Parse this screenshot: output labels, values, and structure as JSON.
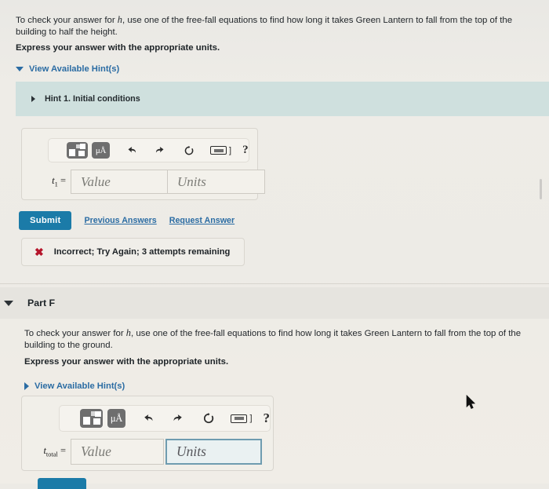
{
  "part_e": {
    "question_prefix": "To check your answer for ",
    "question_var": "h",
    "question_rest": ", use one of the free-fall equations to find how long it takes Green Lantern to fall from the top of the building to half the height.",
    "instruction": "Express your answer with the appropriate units.",
    "hints_toggle": "View Available Hint(s)",
    "hint_item": "Hint 1. Initial conditions",
    "toolbar": {
      "template_label": "template-picker",
      "units_label": "μÅ",
      "undo_label": "undo",
      "redo_label": "redo",
      "reset_label": "reset",
      "keyboard_label": "keyboard-shortcuts",
      "keyboard_bracket": "]",
      "help_label": "?"
    },
    "answer": {
      "lhs_var": "t",
      "lhs_sub": "1",
      "lhs_eq": " =",
      "value_placeholder": "Value",
      "units_placeholder": "Units",
      "value_text": "",
      "units_text": ""
    },
    "submit_label": "Submit",
    "previous_answers_label": "Previous Answers",
    "request_answer_label": "Request Answer",
    "feedback": {
      "icon": "✖",
      "text": "Incorrect; Try Again; 3 attempts remaining"
    }
  },
  "part_f": {
    "header_title": "Part F",
    "question_prefix": "To check your answer for ",
    "question_var": "h",
    "question_rest": ", use one of the free-fall equations to find how long it takes Green Lantern to fall from the top of the building to the ground.",
    "instruction": "Express your answer with the appropriate units.",
    "hints_toggle": "View Available Hint(s)",
    "toolbar": {
      "template_label": "template-picker",
      "units_label": "μÅ",
      "undo_label": "undo",
      "redo_label": "redo",
      "reset_label": "reset",
      "keyboard_label": "keyboard-shortcuts",
      "keyboard_bracket": "]",
      "help_label": "?"
    },
    "answer": {
      "lhs_var": "t",
      "lhs_sub": "total",
      "lhs_eq": " =",
      "value_placeholder": "Value",
      "units_placeholder": "Units",
      "value_text": "",
      "units_text": "",
      "units_focused": true
    }
  },
  "colors": {
    "accent_blue": "#2b6ca3",
    "submit_blue": "#1b7ba8",
    "hint_panel": "#cfe0de",
    "error_red": "#b5152b",
    "focus_border": "#6f9cb0",
    "page_bg": "#eceae5"
  }
}
